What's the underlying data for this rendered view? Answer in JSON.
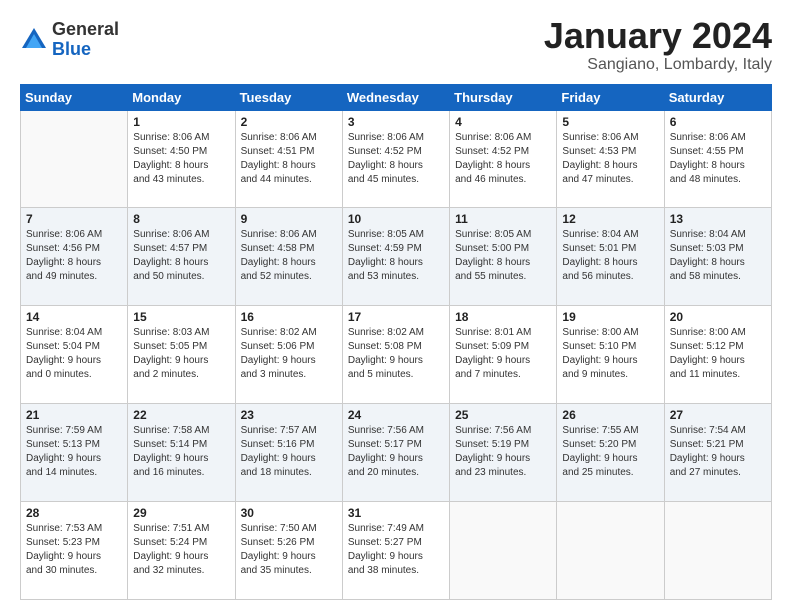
{
  "header": {
    "logo_general": "General",
    "logo_blue": "Blue",
    "month": "January 2024",
    "location": "Sangiano, Lombardy, Italy"
  },
  "weekdays": [
    "Sunday",
    "Monday",
    "Tuesday",
    "Wednesday",
    "Thursday",
    "Friday",
    "Saturday"
  ],
  "weeks": [
    [
      {
        "day": "",
        "info": ""
      },
      {
        "day": "1",
        "info": "Sunrise: 8:06 AM\nSunset: 4:50 PM\nDaylight: 8 hours\nand 43 minutes."
      },
      {
        "day": "2",
        "info": "Sunrise: 8:06 AM\nSunset: 4:51 PM\nDaylight: 8 hours\nand 44 minutes."
      },
      {
        "day": "3",
        "info": "Sunrise: 8:06 AM\nSunset: 4:52 PM\nDaylight: 8 hours\nand 45 minutes."
      },
      {
        "day": "4",
        "info": "Sunrise: 8:06 AM\nSunset: 4:52 PM\nDaylight: 8 hours\nand 46 minutes."
      },
      {
        "day": "5",
        "info": "Sunrise: 8:06 AM\nSunset: 4:53 PM\nDaylight: 8 hours\nand 47 minutes."
      },
      {
        "day": "6",
        "info": "Sunrise: 8:06 AM\nSunset: 4:55 PM\nDaylight: 8 hours\nand 48 minutes."
      }
    ],
    [
      {
        "day": "7",
        "info": "Sunrise: 8:06 AM\nSunset: 4:56 PM\nDaylight: 8 hours\nand 49 minutes."
      },
      {
        "day": "8",
        "info": "Sunrise: 8:06 AM\nSunset: 4:57 PM\nDaylight: 8 hours\nand 50 minutes."
      },
      {
        "day": "9",
        "info": "Sunrise: 8:06 AM\nSunset: 4:58 PM\nDaylight: 8 hours\nand 52 minutes."
      },
      {
        "day": "10",
        "info": "Sunrise: 8:05 AM\nSunset: 4:59 PM\nDaylight: 8 hours\nand 53 minutes."
      },
      {
        "day": "11",
        "info": "Sunrise: 8:05 AM\nSunset: 5:00 PM\nDaylight: 8 hours\nand 55 minutes."
      },
      {
        "day": "12",
        "info": "Sunrise: 8:04 AM\nSunset: 5:01 PM\nDaylight: 8 hours\nand 56 minutes."
      },
      {
        "day": "13",
        "info": "Sunrise: 8:04 AM\nSunset: 5:03 PM\nDaylight: 8 hours\nand 58 minutes."
      }
    ],
    [
      {
        "day": "14",
        "info": "Sunrise: 8:04 AM\nSunset: 5:04 PM\nDaylight: 9 hours\nand 0 minutes."
      },
      {
        "day": "15",
        "info": "Sunrise: 8:03 AM\nSunset: 5:05 PM\nDaylight: 9 hours\nand 2 minutes."
      },
      {
        "day": "16",
        "info": "Sunrise: 8:02 AM\nSunset: 5:06 PM\nDaylight: 9 hours\nand 3 minutes."
      },
      {
        "day": "17",
        "info": "Sunrise: 8:02 AM\nSunset: 5:08 PM\nDaylight: 9 hours\nand 5 minutes."
      },
      {
        "day": "18",
        "info": "Sunrise: 8:01 AM\nSunset: 5:09 PM\nDaylight: 9 hours\nand 7 minutes."
      },
      {
        "day": "19",
        "info": "Sunrise: 8:00 AM\nSunset: 5:10 PM\nDaylight: 9 hours\nand 9 minutes."
      },
      {
        "day": "20",
        "info": "Sunrise: 8:00 AM\nSunset: 5:12 PM\nDaylight: 9 hours\nand 11 minutes."
      }
    ],
    [
      {
        "day": "21",
        "info": "Sunrise: 7:59 AM\nSunset: 5:13 PM\nDaylight: 9 hours\nand 14 minutes."
      },
      {
        "day": "22",
        "info": "Sunrise: 7:58 AM\nSunset: 5:14 PM\nDaylight: 9 hours\nand 16 minutes."
      },
      {
        "day": "23",
        "info": "Sunrise: 7:57 AM\nSunset: 5:16 PM\nDaylight: 9 hours\nand 18 minutes."
      },
      {
        "day": "24",
        "info": "Sunrise: 7:56 AM\nSunset: 5:17 PM\nDaylight: 9 hours\nand 20 minutes."
      },
      {
        "day": "25",
        "info": "Sunrise: 7:56 AM\nSunset: 5:19 PM\nDaylight: 9 hours\nand 23 minutes."
      },
      {
        "day": "26",
        "info": "Sunrise: 7:55 AM\nSunset: 5:20 PM\nDaylight: 9 hours\nand 25 minutes."
      },
      {
        "day": "27",
        "info": "Sunrise: 7:54 AM\nSunset: 5:21 PM\nDaylight: 9 hours\nand 27 minutes."
      }
    ],
    [
      {
        "day": "28",
        "info": "Sunrise: 7:53 AM\nSunset: 5:23 PM\nDaylight: 9 hours\nand 30 minutes."
      },
      {
        "day": "29",
        "info": "Sunrise: 7:51 AM\nSunset: 5:24 PM\nDaylight: 9 hours\nand 32 minutes."
      },
      {
        "day": "30",
        "info": "Sunrise: 7:50 AM\nSunset: 5:26 PM\nDaylight: 9 hours\nand 35 minutes."
      },
      {
        "day": "31",
        "info": "Sunrise: 7:49 AM\nSunset: 5:27 PM\nDaylight: 9 hours\nand 38 minutes."
      },
      {
        "day": "",
        "info": ""
      },
      {
        "day": "",
        "info": ""
      },
      {
        "day": "",
        "info": ""
      }
    ]
  ]
}
